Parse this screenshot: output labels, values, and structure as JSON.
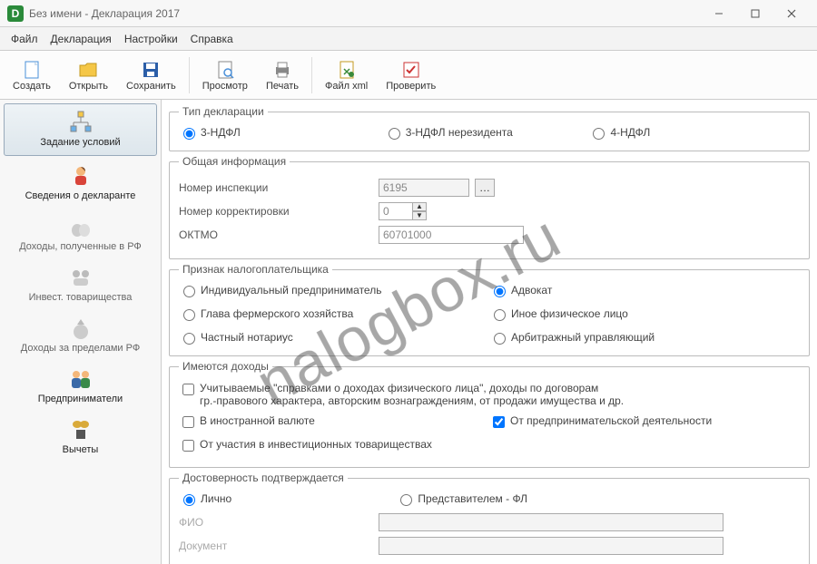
{
  "window": {
    "title": "Без имени - Декларация 2017",
    "app_icon_letter": "D"
  },
  "menu": {
    "file": "Файл",
    "declaration": "Декларация",
    "settings": "Настройки",
    "help": "Справка"
  },
  "toolbar": {
    "create": "Создать",
    "open": "Открыть",
    "save": "Сохранить",
    "preview": "Просмотр",
    "print": "Печать",
    "xml": "Файл xml",
    "check": "Проверить"
  },
  "sidebar": {
    "conditions": "Задание условий",
    "declarant": "Сведения о декларанте",
    "income_rf": "Доходы, полученные в РФ",
    "invest": "Инвест. товарищества",
    "income_abroad": "Доходы за пределами РФ",
    "entrepreneurs": "Предприниматели",
    "deductions": "Вычеты"
  },
  "decl_type": {
    "legend": "Тип декларации",
    "opt1": "3-НДФЛ",
    "opt2": "3-НДФЛ нерезидента",
    "opt3": "4-НДФЛ"
  },
  "general": {
    "legend": "Общая информация",
    "inspection_label": "Номер инспекции",
    "inspection_value": "6195",
    "correction_label": "Номер корректировки",
    "correction_value": "0",
    "oktmo_label": "ОКТМО",
    "oktmo_value": "60701000"
  },
  "taxpayer": {
    "legend": "Признак налогоплательщика",
    "opt1": "Индивидуальный предприниматель",
    "opt2": "Адвокат",
    "opt3": "Глава фермерского хозяйства",
    "opt4": "Иное физическое лицо",
    "opt5": "Частный нотариус",
    "opt6": "Арбитражный управляющий"
  },
  "income": {
    "legend": "Имеются доходы",
    "opt1_line1": "Учитываемые \"справками о доходах физического лица\", доходы по договорам",
    "opt1_line2": "гр.-правового характера, авторским вознаграждениям, от продажи имущества и др.",
    "opt2": "В иностранной валюте",
    "opt3": "От предпринимательской деятельности",
    "opt4": "От участия в инвестиционных товариществах"
  },
  "trust": {
    "legend": "Достоверность подтверждается",
    "opt1": "Лично",
    "opt2": "Представителем - ФЛ",
    "fio_label": "ФИО",
    "fio_value": "",
    "doc_label": "Документ",
    "doc_value": ""
  },
  "watermark": "nalogbox.ru"
}
